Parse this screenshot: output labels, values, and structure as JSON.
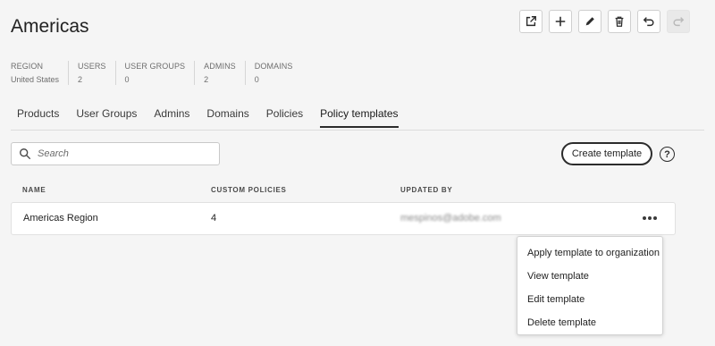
{
  "page": {
    "title": "Americas"
  },
  "toolbar": [
    {
      "name": "open-external-icon",
      "disabled": false
    },
    {
      "name": "add-icon",
      "disabled": false
    },
    {
      "name": "edit-icon",
      "disabled": false
    },
    {
      "name": "delete-icon",
      "disabled": false
    },
    {
      "name": "undo-icon",
      "disabled": false
    },
    {
      "name": "redo-icon",
      "disabled": true
    }
  ],
  "meta": [
    {
      "label": "REGION",
      "value": "United States"
    },
    {
      "label": "USERS",
      "value": "2"
    },
    {
      "label": "USER GROUPS",
      "value": "0"
    },
    {
      "label": "ADMINS",
      "value": "2"
    },
    {
      "label": "DOMAINS",
      "value": "0"
    }
  ],
  "tabs": [
    {
      "label": "Products",
      "active": false
    },
    {
      "label": "User Groups",
      "active": false
    },
    {
      "label": "Admins",
      "active": false
    },
    {
      "label": "Domains",
      "active": false
    },
    {
      "label": "Policies",
      "active": false
    },
    {
      "label": "Policy templates",
      "active": true
    }
  ],
  "search": {
    "placeholder": "Search",
    "value": ""
  },
  "actions": {
    "create_label": "Create template",
    "help_label": "?"
  },
  "table": {
    "columns": [
      "NAME",
      "CUSTOM POLICIES",
      "UPDATED BY"
    ],
    "rows": [
      {
        "name": "Americas Region",
        "custom_policies": "4",
        "updated_by": "mespinos@adobe.com"
      }
    ]
  },
  "menu": {
    "items": [
      "Apply template to organization",
      "View template",
      "Edit template",
      "Delete template"
    ]
  },
  "colors": {
    "accent": "#2c2c2c",
    "background": "#f5f5f5"
  }
}
